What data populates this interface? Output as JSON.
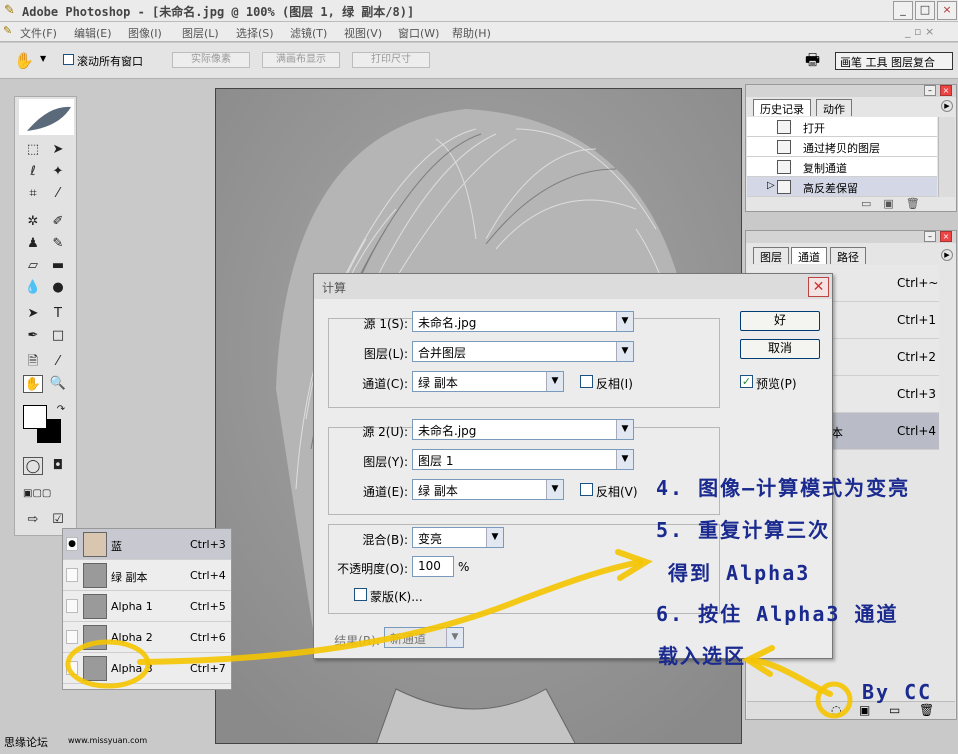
{
  "window": {
    "title": "Adobe Photoshop - [未命名.jpg @ 100% (图层 1, 绿 副本/8)]",
    "min": "_",
    "max": "□",
    "close": "×"
  },
  "menu": [
    "文件(F)",
    "编辑(E)",
    "图像(I)",
    "图层(L)",
    "选择(S)",
    "滤镜(T)",
    "视图(V)",
    "窗口(W)",
    "帮助(H)"
  ],
  "options": {
    "scroll_all": "滚动所有窗口",
    "actual_pixels": "实际像素",
    "fit_screen": "满画布显示",
    "print_size": "打印尺寸",
    "palette_well": "画笔 工具 图层复合"
  },
  "channels_mini": [
    {
      "name": "蓝",
      "shortcut": "Ctrl+3",
      "visible": "●"
    },
    {
      "name": "绿 副本",
      "shortcut": "Ctrl+4",
      "visible": ""
    },
    {
      "name": "Alpha 1",
      "shortcut": "Ctrl+5",
      "visible": ""
    },
    {
      "name": "Alpha 2",
      "shortcut": "Ctrl+6",
      "visible": ""
    },
    {
      "name": "Alpha 3",
      "shortcut": "Ctrl+7",
      "visible": ""
    }
  ],
  "history": {
    "tab1": "历史记录",
    "tab2": "动作",
    "items": [
      "打开",
      "通过拷贝的图层",
      "复制通道",
      "高反差保留"
    ]
  },
  "channels": {
    "tab1": "图层",
    "tab2": "通道",
    "tab3": "路径",
    "shortcuts": [
      "Ctrl+~",
      "Ctrl+1",
      "Ctrl+2",
      "Ctrl+3",
      "Ctrl+4"
    ],
    "partial_name": "本"
  },
  "dialog": {
    "title": "计算",
    "src1_label": "源 1(S):",
    "src1": "未命名.jpg",
    "layer1_label": "图层(L):",
    "layer1": "合并图层",
    "chan1_label": "通道(C):",
    "chan1": "绿 副本",
    "invert1": "反相(I)",
    "src2_label": "源 2(U):",
    "src2": "未命名.jpg",
    "layer2_label": "图层(Y):",
    "layer2": "图层 1",
    "chan2_label": "通道(E):",
    "chan2": "绿 副本",
    "invert2": "反相(V)",
    "blend_label": "混合(B):",
    "blend": "变亮",
    "opacity_label": "不透明度(O):",
    "opacity": "100",
    "pct": "%",
    "mask": "蒙版(K)...",
    "result_label": "结果(R):",
    "result": "新通道",
    "ok": "好",
    "cancel": "取消",
    "preview": "预览(P)",
    "preview_checked": "✓"
  },
  "annotations": [
    "4. 图像—计算模式为变亮",
    "5. 重复计算三次",
    "得到 Alpha3",
    "6. 按住 Alpha3 通道",
    "载入选区",
    "By CC"
  ],
  "footer": {
    "site": "思缘论坛",
    "url": "www.missyuan.com"
  }
}
